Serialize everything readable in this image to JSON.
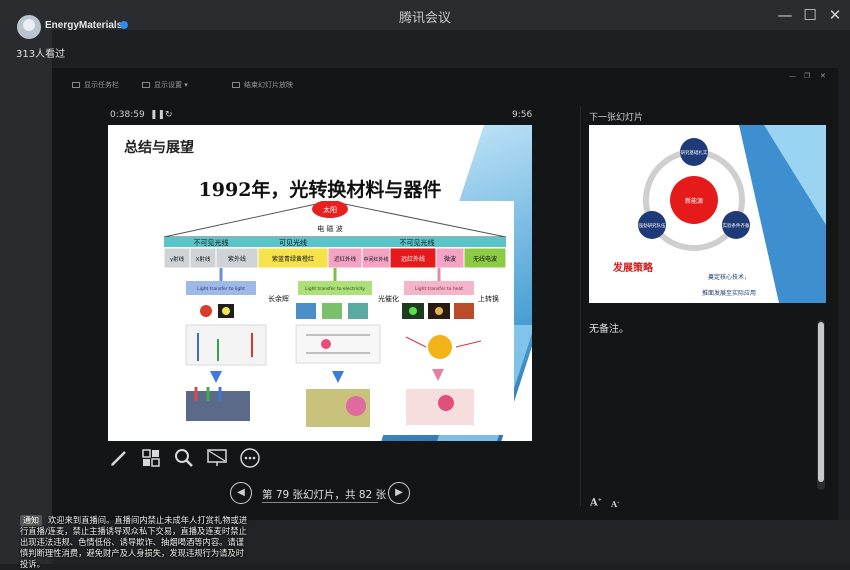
{
  "window": {
    "title": "腾讯会议"
  },
  "account": {
    "name": "EnergyMaterials",
    "viewers": "313人看过"
  },
  "presenter_toolbar": [
    "显示任务栏",
    "显示设置",
    "结束幻灯片放映"
  ],
  "presenter": {
    "elapsed": "0:38:59",
    "clock": "9:56",
    "next_label": "下一张幻灯片",
    "notes": "无备注。",
    "counter": "第 79 张幻灯片，共 82 张",
    "font_up": "A",
    "font_down": "A"
  },
  "slide": {
    "heading": "总结与展望",
    "title": "1992年，光转换材料与器件",
    "sun": "太阳",
    "em_wave": "电 磁 波",
    "bands": [
      "不可见光线",
      "可见光线",
      "不可见光线"
    ],
    "segments": [
      "γ射线",
      "X射线",
      "紫外线",
      "紫蓝青绿黄橙红",
      "近红外线",
      "中间红外线",
      "远红外线",
      "微波",
      "无线电波"
    ],
    "columns": [
      {
        "title": "Light transfer to light",
        "label": "长余辉"
      },
      {
        "title": "Light transfer to electricity",
        "label": "光催化"
      },
      {
        "title": "Light transfer to heat",
        "label": "上转换"
      }
    ]
  },
  "next_slide": {
    "center": "新能源",
    "nodes": [
      "研究基础扎实",
      "强劲研究队伍",
      "实验条件齐备"
    ],
    "caption": "发展策略",
    "line1": "奠定核心技术，",
    "line2": "推面发展至实际应用"
  },
  "notice": {
    "tag": "通知",
    "text": "欢迎来到直播间。直播间内禁止未成年人打赏礼物或进行直播/连麦，禁止主播诱导观众私下交易，直播及连麦时禁止出现违法违规、色情低俗、诱导欺诈、抽烟喝酒等内容。请谨慎判断理性消费，避免财产及人身损失，发现违规行为请及时投诉。"
  },
  "colors": {
    "sun": "#e8201e",
    "band": "#59c5c9",
    "segment_gray": "#cfd3d6",
    "segment_yellow": "#f6e24a",
    "segment_pink": "#f4a3c4",
    "segment_red": "#e51b1b",
    "segment_green": "#8ccc45",
    "accent": "#2d8cf0"
  }
}
